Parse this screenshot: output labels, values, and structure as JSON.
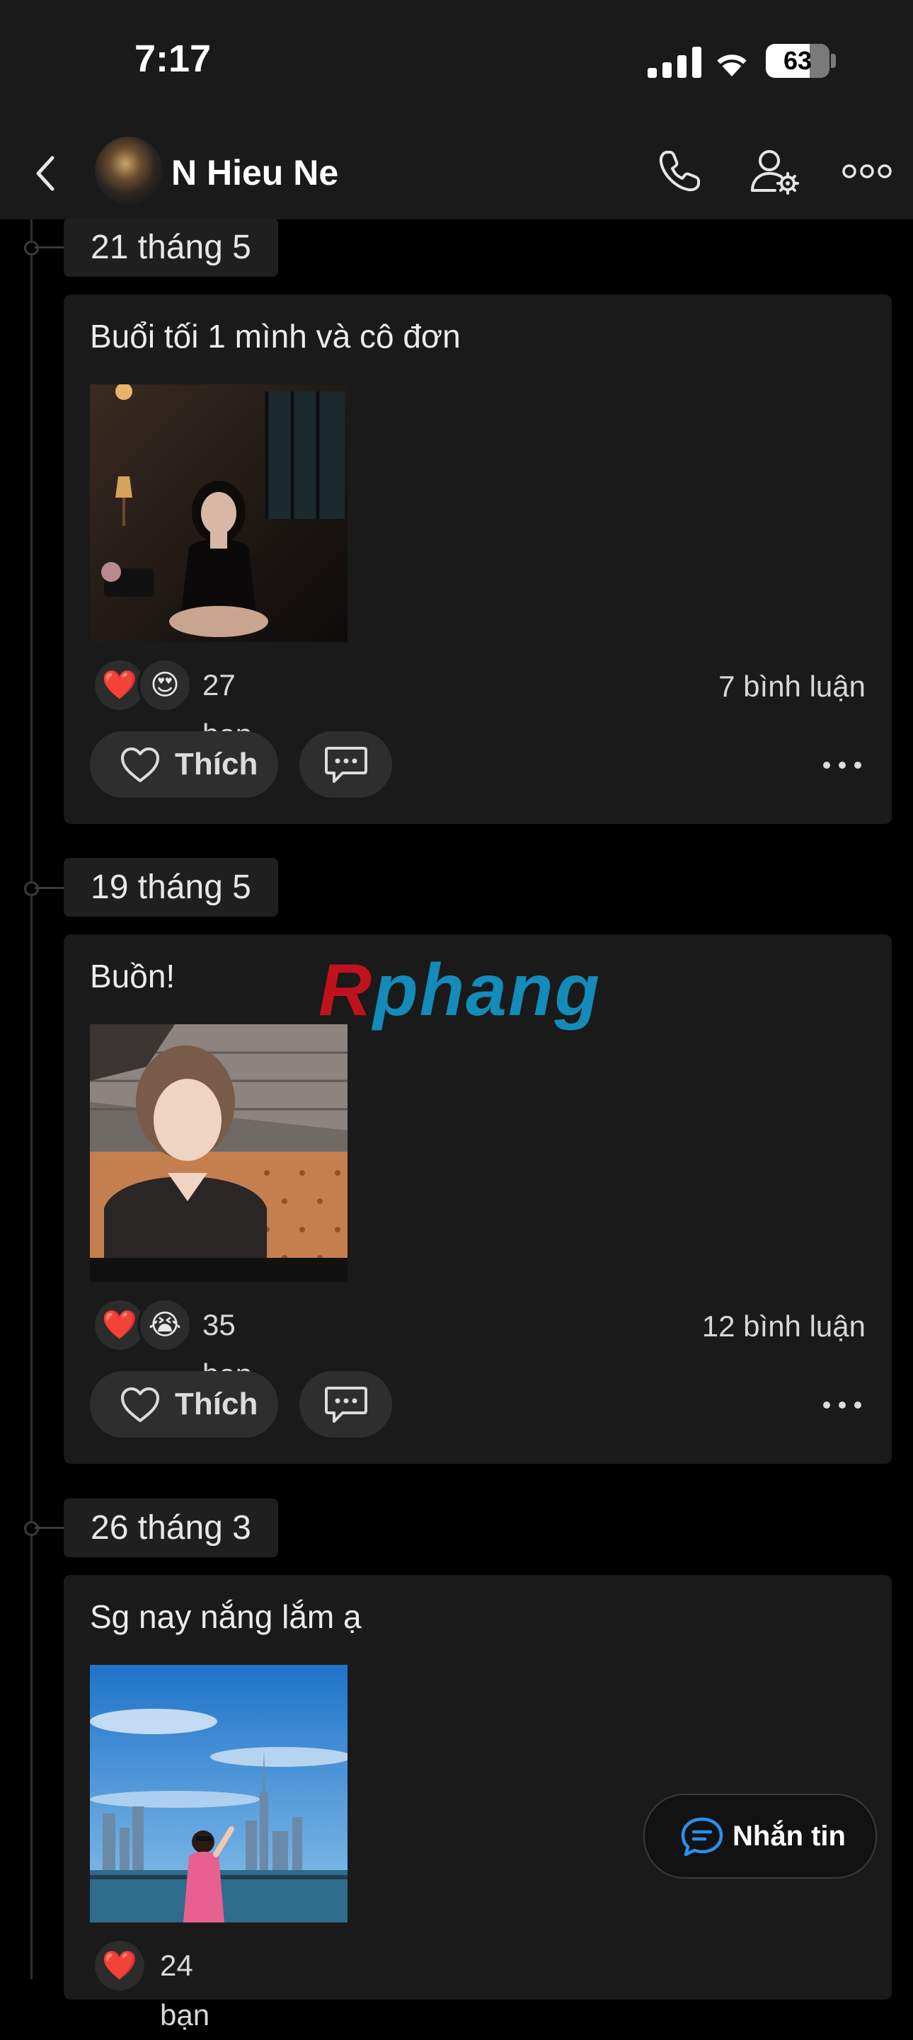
{
  "status_bar": {
    "time": "7:17",
    "battery": "63"
  },
  "header": {
    "contact_name": "N Hieu Ne"
  },
  "watermark": {
    "first": "R",
    "rest": "phang"
  },
  "posts": [
    {
      "date": "21 tháng 5",
      "text": "Buổi tối 1 mình và cô đơn",
      "reactions": [
        "❤️",
        "😍"
      ],
      "like_count": "27 bạn",
      "comment_count": "7 bình luận",
      "like_label": "Thích"
    },
    {
      "date": "19 tháng 5",
      "text": "Buồn!",
      "reactions": [
        "❤️",
        "😭"
      ],
      "like_count": "35 bạn",
      "comment_count": "12 bình luận",
      "like_label": "Thích"
    },
    {
      "date": "26 tháng 3",
      "text": "Sg nay nắng lắm ạ",
      "reactions": [
        "❤️"
      ],
      "like_count": "24 bạn"
    }
  ],
  "message_button": {
    "label": "Nhắn tin"
  },
  "icons": {
    "back": "chevron-left-icon",
    "call": "phone-icon",
    "profile_settings": "user-gear-icon",
    "more": "more-horizontal-icon",
    "like": "heart-outline-icon",
    "comment": "chat-bubble-icon",
    "message": "message-bubble-icon"
  }
}
